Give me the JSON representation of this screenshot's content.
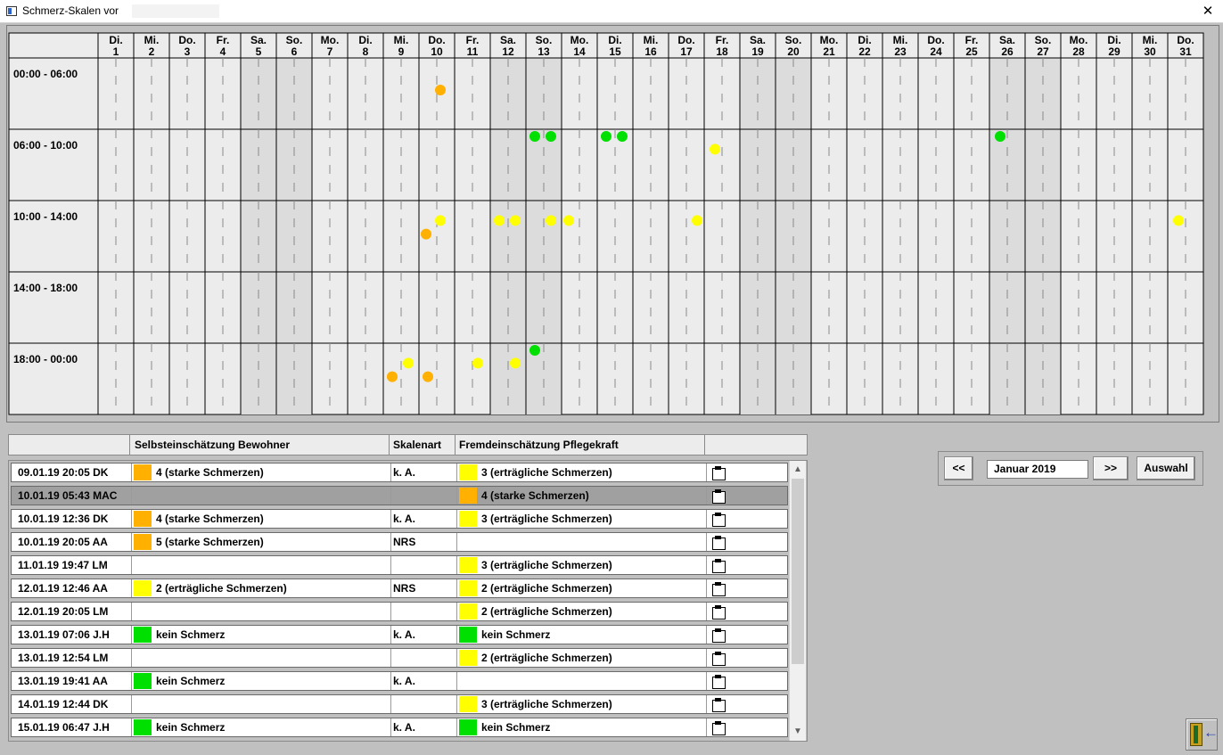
{
  "window": {
    "title": "Schmerz-Skalen vor",
    "close_symbol": "✕"
  },
  "chart_data": {
    "type": "scatter",
    "title": "",
    "days": [
      {
        "day": "Di.",
        "num": "1",
        "weekend": false
      },
      {
        "day": "Mi.",
        "num": "2",
        "weekend": false
      },
      {
        "day": "Do.",
        "num": "3",
        "weekend": false
      },
      {
        "day": "Fr.",
        "num": "4",
        "weekend": false
      },
      {
        "day": "Sa.",
        "num": "5",
        "weekend": true
      },
      {
        "day": "So.",
        "num": "6",
        "weekend": true
      },
      {
        "day": "Mo.",
        "num": "7",
        "weekend": false
      },
      {
        "day": "Di.",
        "num": "8",
        "weekend": false
      },
      {
        "day": "Mi.",
        "num": "9",
        "weekend": false
      },
      {
        "day": "Do.",
        "num": "10",
        "weekend": false
      },
      {
        "day": "Fr.",
        "num": "11",
        "weekend": false
      },
      {
        "day": "Sa.",
        "num": "12",
        "weekend": true
      },
      {
        "day": "So.",
        "num": "13",
        "weekend": true
      },
      {
        "day": "Mo.",
        "num": "14",
        "weekend": false
      },
      {
        "day": "Di.",
        "num": "15",
        "weekend": false
      },
      {
        "day": "Mi.",
        "num": "16",
        "weekend": false
      },
      {
        "day": "Do.",
        "num": "17",
        "weekend": false
      },
      {
        "day": "Fr.",
        "num": "18",
        "weekend": false
      },
      {
        "day": "Sa.",
        "num": "19",
        "weekend": true
      },
      {
        "day": "So.",
        "num": "20",
        "weekend": true
      },
      {
        "day": "Mo.",
        "num": "21",
        "weekend": false
      },
      {
        "day": "Di.",
        "num": "22",
        "weekend": false
      },
      {
        "day": "Mi.",
        "num": "23",
        "weekend": false
      },
      {
        "day": "Do.",
        "num": "24",
        "weekend": false
      },
      {
        "day": "Fr.",
        "num": "25",
        "weekend": false
      },
      {
        "day": "Sa.",
        "num": "26",
        "weekend": true
      },
      {
        "day": "So.",
        "num": "27",
        "weekend": true
      },
      {
        "day": "Mo.",
        "num": "28",
        "weekend": false
      },
      {
        "day": "Di.",
        "num": "29",
        "weekend": false
      },
      {
        "day": "Mi.",
        "num": "30",
        "weekend": false
      },
      {
        "day": "Do.",
        "num": "31",
        "weekend": false
      }
    ],
    "time_slots": [
      "00:00 - 06:00",
      "06:00 - 10:00",
      "10:00 - 14:00",
      "14:00 - 18:00",
      "18:00 - 00:00"
    ],
    "colors": {
      "orange": "#ffb000",
      "yellow": "#ffff00",
      "green": "#00e000"
    },
    "points": [
      {
        "day": 10,
        "slot": 0,
        "sub": 0.6,
        "v": 0.45,
        "color": "orange"
      },
      {
        "day": 13,
        "slot": 1,
        "sub": 0.25,
        "v": 0.1,
        "color": "green"
      },
      {
        "day": 13,
        "slot": 1,
        "sub": 0.7,
        "v": 0.1,
        "color": "green"
      },
      {
        "day": 15,
        "slot": 1,
        "sub": 0.25,
        "v": 0.1,
        "color": "green"
      },
      {
        "day": 15,
        "slot": 1,
        "sub": 0.7,
        "v": 0.1,
        "color": "green"
      },
      {
        "day": 18,
        "slot": 1,
        "sub": 0.3,
        "v": 0.28,
        "color": "yellow"
      },
      {
        "day": 26,
        "slot": 1,
        "sub": 0.3,
        "v": 0.1,
        "color": "green"
      },
      {
        "day": 10,
        "slot": 2,
        "sub": 0.2,
        "v": 0.47,
        "color": "orange"
      },
      {
        "day": 10,
        "slot": 2,
        "sub": 0.6,
        "v": 0.28,
        "color": "yellow"
      },
      {
        "day": 12,
        "slot": 2,
        "sub": 0.25,
        "v": 0.28,
        "color": "yellow"
      },
      {
        "day": 12,
        "slot": 2,
        "sub": 0.7,
        "v": 0.28,
        "color": "yellow"
      },
      {
        "day": 13,
        "slot": 2,
        "sub": 0.7,
        "v": 0.28,
        "color": "yellow"
      },
      {
        "day": 14,
        "slot": 2,
        "sub": 0.2,
        "v": 0.28,
        "color": "yellow"
      },
      {
        "day": 17,
        "slot": 2,
        "sub": 0.8,
        "v": 0.28,
        "color": "yellow"
      },
      {
        "day": 31,
        "slot": 2,
        "sub": 0.3,
        "v": 0.28,
        "color": "yellow"
      },
      {
        "day": 9,
        "slot": 4,
        "sub": 0.25,
        "v": 0.47,
        "color": "orange"
      },
      {
        "day": 9,
        "slot": 4,
        "sub": 0.7,
        "v": 0.28,
        "color": "yellow"
      },
      {
        "day": 10,
        "slot": 4,
        "sub": 0.25,
        "v": 0.47,
        "color": "orange"
      },
      {
        "day": 11,
        "slot": 4,
        "sub": 0.65,
        "v": 0.28,
        "color": "yellow"
      },
      {
        "day": 12,
        "slot": 4,
        "sub": 0.7,
        "v": 0.28,
        "color": "yellow"
      },
      {
        "day": 13,
        "slot": 4,
        "sub": 0.25,
        "v": 0.1,
        "color": "green"
      }
    ]
  },
  "table": {
    "headers": {
      "date": "",
      "self": "Selbsteinschätzung Bewohner",
      "scale": "Skalenart",
      "foreign": "Fremdeinschätzung Pflegekraft",
      "action": ""
    },
    "swatch_colors": {
      "orange": "#ffb000",
      "yellow": "#ffff00",
      "green": "#00e000"
    },
    "rows": [
      {
        "date": "09.01.19 20:05 DK",
        "self": "4 (starke Schmerzen)",
        "self_color": "orange",
        "scale": "k. A.",
        "foreign": "3 (erträgliche Schmerzen)",
        "foreign_color": "yellow",
        "selected": false
      },
      {
        "date": "10.01.19 05:43 MAC",
        "self": "",
        "self_color": "",
        "scale": "",
        "foreign": "4 (starke Schmerzen)",
        "foreign_color": "orange",
        "selected": true
      },
      {
        "date": "10.01.19 12:36 DK",
        "self": "4 (starke Schmerzen)",
        "self_color": "orange",
        "scale": "k. A.",
        "foreign": "3 (erträgliche Schmerzen)",
        "foreign_color": "yellow",
        "selected": false
      },
      {
        "date": "10.01.19 20:05 AA",
        "self": "5 (starke Schmerzen)",
        "self_color": "orange",
        "scale": "NRS",
        "foreign": "",
        "foreign_color": "",
        "selected": false
      },
      {
        "date": "11.01.19 19:47 LM",
        "self": "",
        "self_color": "",
        "scale": "",
        "foreign": "3 (erträgliche Schmerzen)",
        "foreign_color": "yellow",
        "selected": false
      },
      {
        "date": "12.01.19 12:46 AA",
        "self": "2 (erträgliche Schmerzen)",
        "self_color": "yellow",
        "scale": "NRS",
        "foreign": "2 (erträgliche Schmerzen)",
        "foreign_color": "yellow",
        "selected": false
      },
      {
        "date": "12.01.19 20:05 LM",
        "self": "",
        "self_color": "",
        "scale": "",
        "foreign": "2 (erträgliche Schmerzen)",
        "foreign_color": "yellow",
        "selected": false
      },
      {
        "date": "13.01.19 07:06 J.H",
        "self": "kein Schmerz",
        "self_color": "green",
        "scale": "k. A.",
        "foreign": "kein Schmerz",
        "foreign_color": "green",
        "selected": false
      },
      {
        "date": "13.01.19 12:54 LM",
        "self": "",
        "self_color": "",
        "scale": "",
        "foreign": "2 (erträgliche Schmerzen)",
        "foreign_color": "yellow",
        "selected": false
      },
      {
        "date": "13.01.19 19:41 AA",
        "self": "kein Schmerz",
        "self_color": "green",
        "scale": "k. A.",
        "foreign": "",
        "foreign_color": "",
        "selected": false
      },
      {
        "date": "14.01.19 12:44 DK",
        "self": "",
        "self_color": "",
        "scale": "",
        "foreign": "3 (erträgliche Schmerzen)",
        "foreign_color": "yellow",
        "selected": false
      },
      {
        "date": "15.01.19 06:47 J.H",
        "self": "kein Schmerz",
        "self_color": "green",
        "scale": "k. A.",
        "foreign": "kein Schmerz",
        "foreign_color": "green",
        "selected": false
      }
    ]
  },
  "nav": {
    "prev_label": "<<",
    "month": "Januar 2019",
    "next_label": ">>",
    "select_label": "Auswahl"
  },
  "scrollbar": {
    "up": "▲",
    "down": "▼"
  }
}
